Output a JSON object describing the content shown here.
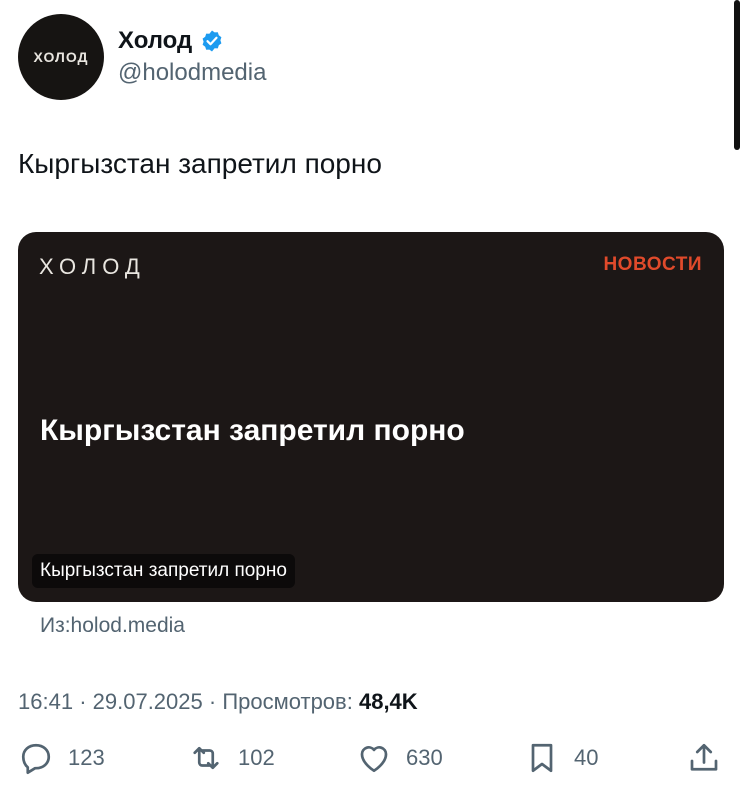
{
  "author": {
    "avatar_text": "ХОЛОД",
    "display_name": "Холод",
    "handle": "@holodmedia",
    "verified_color": "#1d9bf0"
  },
  "tweet": {
    "text": "Кыргызстан запретил порно"
  },
  "card": {
    "logo": "ХОЛОД",
    "rubric": "НОВОСТИ",
    "headline": "Кыргызстан запретил порно",
    "caption": "Кыргызстан запретил порно",
    "source": "Из:holod.media",
    "colors": {
      "background": "#1c1716",
      "rubric": "#e04a2b"
    }
  },
  "meta": {
    "time": "16:41",
    "date": "29.07.2025",
    "views_label": "Просмотров:",
    "views_count": "48,4K"
  },
  "actions": {
    "replies": "123",
    "reposts": "102",
    "likes": "630",
    "bookmarks": "40"
  }
}
